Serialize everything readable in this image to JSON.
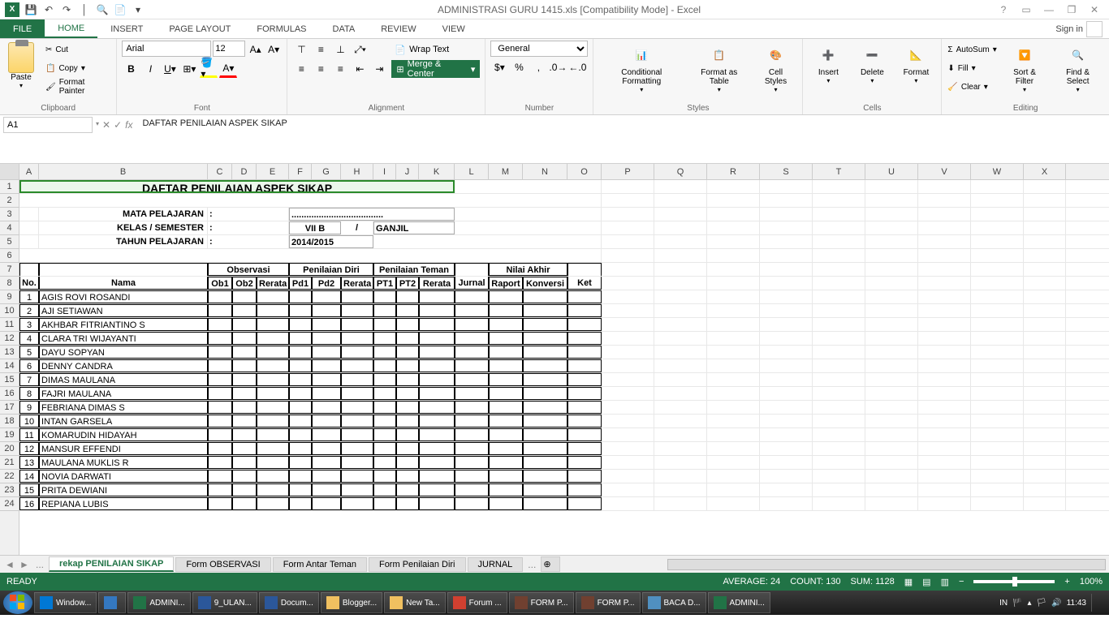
{
  "titlebar": {
    "text": "ADMINISTRASI GURU 1415.xls  [Compatibility Mode] - Excel"
  },
  "ribbon": {
    "tabs": [
      "FILE",
      "HOME",
      "INSERT",
      "PAGE LAYOUT",
      "FORMULAS",
      "DATA",
      "REVIEW",
      "VIEW"
    ],
    "signin": "Sign in",
    "clipboard": {
      "cut": "Cut",
      "copy": "Copy",
      "format_painter": "Format Painter",
      "paste": "Paste",
      "label": "Clipboard"
    },
    "font": {
      "name": "Arial",
      "size": "12",
      "label": "Font"
    },
    "alignment": {
      "wrap": "Wrap Text",
      "merge": "Merge & Center",
      "label": "Alignment"
    },
    "number": {
      "format": "General",
      "label": "Number"
    },
    "styles": {
      "cond": "Conditional Formatting",
      "table": "Format as Table",
      "cell": "Cell Styles",
      "label": "Styles"
    },
    "cells": {
      "insert": "Insert",
      "delete": "Delete",
      "format": "Format",
      "label": "Cells"
    },
    "editing": {
      "autosum": "AutoSum",
      "fill": "Fill",
      "clear": "Clear",
      "sort": "Sort & Filter",
      "find": "Find & Select",
      "label": "Editing"
    }
  },
  "formula_bar": {
    "ref": "A1",
    "fx": "fx",
    "content": "DAFTAR PENILAIAN ASPEK SIKAP"
  },
  "columns": [
    "A",
    "B",
    "C",
    "D",
    "E",
    "F",
    "G",
    "H",
    "I",
    "J",
    "K",
    "L",
    "M",
    "N",
    "O",
    "P",
    "Q",
    "R",
    "S",
    "T",
    "U",
    "V",
    "W",
    "X"
  ],
  "sheet": {
    "title": "DAFTAR PENILAIAN ASPEK SIKAP",
    "meta": {
      "mata_label": "MATA PELAJARAN",
      "mata_colon": ":",
      "mata_val": ".....................................",
      "kelas_label": "KELAS / SEMESTER",
      "kelas_colon": ":",
      "kelas_val": "VII B",
      "slash": "/",
      "sem_val": "GANJIL",
      "tahun_label": "TAHUN PELAJARAN",
      "tahun_colon": ":",
      "tahun_val": "2014/2015"
    },
    "headers": {
      "no": "No.",
      "nama": "Nama",
      "observasi": "Observasi",
      "pen_diri": "Penilaian Diri",
      "pen_teman": "Penilaian Teman",
      "jurnal": "Jurnal",
      "nilai_akhir": "Nilai Akhir",
      "ket": "Ket",
      "ob1": "Ob1",
      "ob2": "Ob2",
      "rerata": "Rerata",
      "pd1": "Pd1",
      "pd2": "Pd2",
      "pt1": "PT1",
      "pt2": "PT2",
      "raport": "Raport",
      "konversi": "Konversi"
    },
    "students": [
      {
        "no": "1",
        "name": "AGIS ROVI ROSANDI"
      },
      {
        "no": "2",
        "name": "AJI SETIAWAN"
      },
      {
        "no": "3",
        "name": "AKHBAR FITRIANTINO S"
      },
      {
        "no": "4",
        "name": "CLARA TRI WIJAYANTI"
      },
      {
        "no": "5",
        "name": "DAYU SOPYAN"
      },
      {
        "no": "6",
        "name": "DENNY CANDRA"
      },
      {
        "no": "7",
        "name": "DIMAS MAULANA"
      },
      {
        "no": "8",
        "name": "FAJRI MAULANA"
      },
      {
        "no": "9",
        "name": "FEBRIANA DIMAS S"
      },
      {
        "no": "10",
        "name": "INTAN GARSELA"
      },
      {
        "no": "11",
        "name": "KOMARUDIN HIDAYAH"
      },
      {
        "no": "12",
        "name": "MANSUR EFFENDI"
      },
      {
        "no": "13",
        "name": "MAULANA MUKLIS R"
      },
      {
        "no": "14",
        "name": "NOVIA DARWATI"
      },
      {
        "no": "15",
        "name": "PRITA DEWIANI"
      },
      {
        "no": "16",
        "name": "REPIANA LUBIS"
      }
    ]
  },
  "sheet_tabs": [
    "rekap PENILAIAN SIKAP",
    "Form OBSERVASI",
    "Form Antar Teman",
    "Form Penilaian Diri",
    "JURNAL"
  ],
  "status": {
    "ready": "READY",
    "avg": "AVERAGE: 24",
    "count": "COUNT: 130",
    "sum": "SUM: 1128",
    "zoom": "100%"
  },
  "taskbar": {
    "items": [
      "Window...",
      "",
      "ADMINI...",
      "9_ULAN...",
      "Docum...",
      "Blogger...",
      "New Ta...",
      "Forum ...",
      "FORM P...",
      "FORM P...",
      "BACA D...",
      "ADMINI..."
    ],
    "tray": {
      "lang": "IN",
      "time": "11:43"
    }
  }
}
